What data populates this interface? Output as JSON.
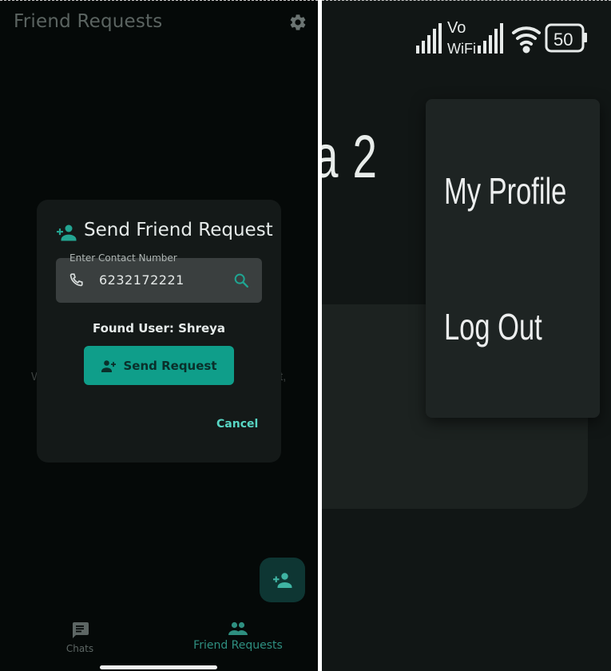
{
  "left_screen": {
    "app_bar": {
      "title": "Friend Requests"
    },
    "background": {
      "partial_left": "W",
      "partial_right": "t,"
    },
    "dialog": {
      "title": "Send Friend Request",
      "field_label": "Enter Contact Number",
      "field_value": "6232172221",
      "found_user": "Found User: Shreya",
      "send_label": "Send Request",
      "cancel_label": "Cancel"
    },
    "bottom_nav": {
      "items": [
        {
          "label": "Chats",
          "selected": false
        },
        {
          "label": "Friend Requests",
          "selected": true
        }
      ]
    },
    "colors": {
      "accent": "#0f9e8a",
      "background": "#050908",
      "dialog": "#141918"
    }
  },
  "right_screen": {
    "status_bar": {
      "network_label_top": "Vo",
      "network_label_bottom": "WiFi",
      "battery": "50"
    },
    "background_fragment": "a 2",
    "menu": {
      "items": [
        {
          "label": "My Profile"
        },
        {
          "label": "Log Out"
        }
      ]
    }
  }
}
